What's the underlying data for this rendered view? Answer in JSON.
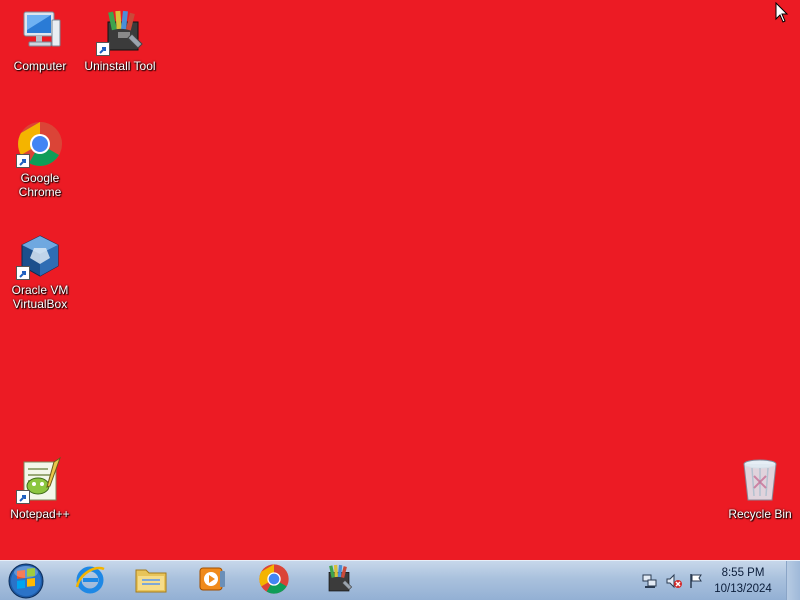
{
  "desktop": {
    "background_color": "#ec1b24",
    "icons": [
      {
        "label": "Computer",
        "icon": "computer-icon"
      },
      {
        "label": "Uninstall Tool",
        "icon": "uninstall-tool-icon"
      },
      {
        "label": "Google\nChrome",
        "icon": "chrome-icon"
      },
      {
        "label": "Oracle VM\nVirtualBox",
        "icon": "virtualbox-icon"
      },
      {
        "label": "Notepad++",
        "icon": "notepad-plus-plus-icon"
      },
      {
        "label": "Recycle Bin",
        "icon": "recycle-bin-icon"
      }
    ]
  },
  "taskbar": {
    "pinned": [
      {
        "name": "Internet Explorer",
        "icon": "internet-explorer-icon"
      },
      {
        "name": "Windows Explorer",
        "icon": "file-explorer-icon"
      },
      {
        "name": "Windows Media Player",
        "icon": "media-player-icon"
      },
      {
        "name": "Google Chrome",
        "icon": "chrome-icon"
      },
      {
        "name": "Uninstall Tool",
        "icon": "uninstall-tool-icon"
      }
    ],
    "tray": {
      "icons": [
        "network-icon",
        "volume-muted-icon",
        "action-center-flag-icon"
      ],
      "time": "8:55 PM",
      "date": "10/13/2024"
    }
  }
}
